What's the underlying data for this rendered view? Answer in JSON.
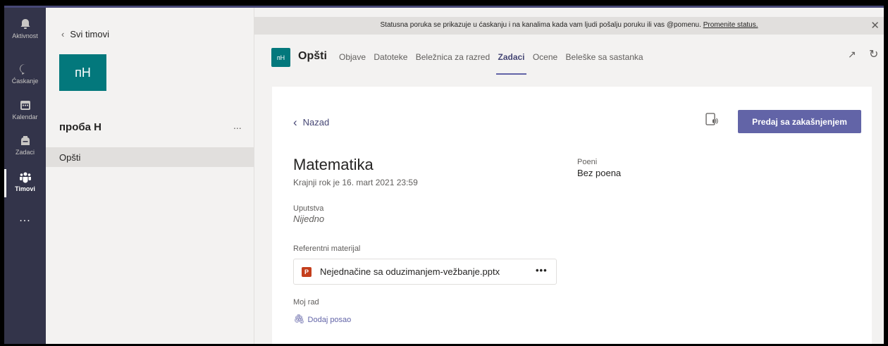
{
  "rail": {
    "items": [
      {
        "label": "Aktivnost"
      },
      {
        "label": "Ćaskanje"
      },
      {
        "label": "Kalendar"
      },
      {
        "label": "Zadaci"
      },
      {
        "label": "Timovi"
      }
    ],
    "more": "..."
  },
  "teams_panel": {
    "back_label": "Svi timovi",
    "team_avatar": "пH",
    "team_name": "проба Н",
    "team_menu": "...",
    "channel": "Opšti"
  },
  "banner": {
    "text": "Statusna poruka se prikazuje u ćaskanju i na kanalima kada vam ljudi pošalju poruku ili vas @pomenu.",
    "link": "Promenite status."
  },
  "channel_header": {
    "avatar": "пH",
    "title": "Opšti",
    "tabs": [
      "Objave",
      "Datoteke",
      "Beležnica za razred",
      "Zadaci",
      "Ocene",
      "Beleške sa sastanka"
    ],
    "active_tab": "Zadaci"
  },
  "assignment": {
    "back_label": "Nazad",
    "submit_label": "Predaj sa zakašnjenjem",
    "title": "Matematika",
    "due": "Krajnji rok je 16. mart 2021 23:59",
    "points_label": "Poeni",
    "points_value": "Bez poena",
    "instructions_label": "Uputstva",
    "instructions_value": "Nijedno",
    "reference_label": "Referentni materijal",
    "reference_file": "Nejednačine sa oduzimanjem-vežbanje.pptx",
    "my_work_label": "Moj rad",
    "add_work_label": "Dodaj posao"
  },
  "colors": {
    "accent": "#6264a7",
    "rail": "#33344a",
    "team": "#03787c"
  }
}
